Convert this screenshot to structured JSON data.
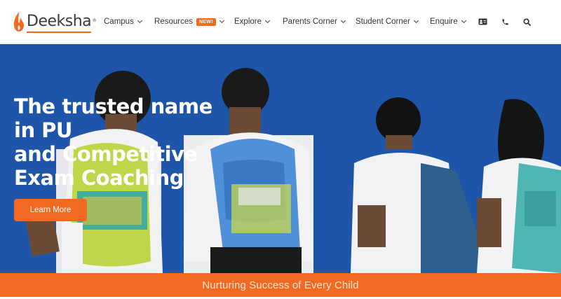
{
  "brand": {
    "name": "Deeksha",
    "reg_mark": "®",
    "accent": "#f26a21",
    "hero_bg": "#1f55a8"
  },
  "nav": {
    "items": [
      {
        "label": "Campus",
        "has_dropdown": true
      },
      {
        "label": "Resources",
        "has_dropdown": true,
        "badge": "NEW!"
      },
      {
        "label": "Explore",
        "has_dropdown": true
      },
      {
        "label": "Parents Corner",
        "has_dropdown": true
      },
      {
        "label": "Student Corner",
        "has_dropdown": true
      },
      {
        "label": "Enquire",
        "has_dropdown": true
      }
    ],
    "icons": [
      "id-card-icon",
      "phone-icon",
      "search-icon"
    ]
  },
  "hero": {
    "title_lines": [
      "The trusted name",
      "in PU",
      "and Competitive",
      "Exam Coaching"
    ],
    "cta_label": "Learn More"
  },
  "tagline": {
    "text": "Nurturing Success of Every Child"
  }
}
